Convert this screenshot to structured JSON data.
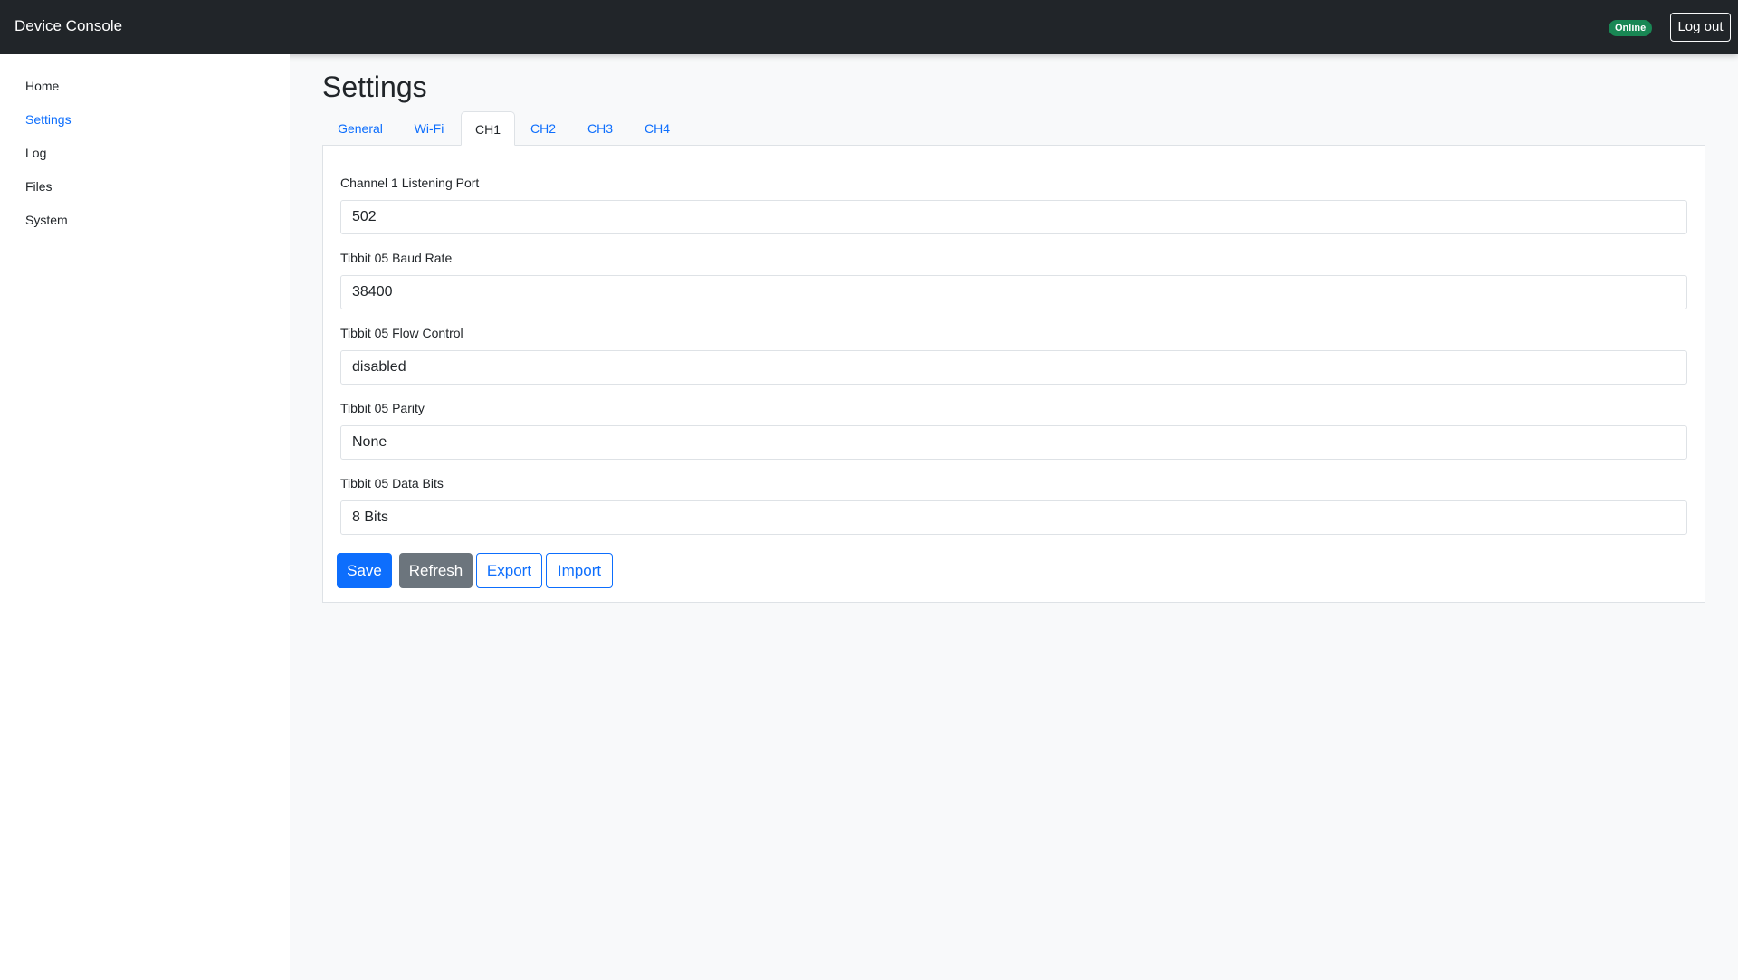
{
  "app": {
    "title": "Device Console"
  },
  "header": {
    "status": "Online",
    "logout_label": "Log out"
  },
  "sidebar": {
    "items": [
      {
        "label": "Home"
      },
      {
        "label": "Settings",
        "active": true
      },
      {
        "label": "Log"
      },
      {
        "label": "Files"
      },
      {
        "label": "System"
      }
    ]
  },
  "page": {
    "title": "Settings"
  },
  "tabs": [
    {
      "label": "General"
    },
    {
      "label": "Wi-Fi"
    },
    {
      "label": "CH1",
      "active": true
    },
    {
      "label": "CH2"
    },
    {
      "label": "CH3"
    },
    {
      "label": "CH4"
    }
  ],
  "form": {
    "fields": [
      {
        "label": "Channel 1 Listening Port",
        "value": "502"
      },
      {
        "label": "Tibbit 05 Baud Rate",
        "value": "38400"
      },
      {
        "label": "Tibbit 05 Flow Control",
        "value": "disabled"
      },
      {
        "label": "Tibbit 05 Parity",
        "value": "None"
      },
      {
        "label": "Tibbit 05 Data Bits",
        "value": "8 Bits"
      }
    ]
  },
  "actions": {
    "save_label": "Save",
    "refresh_label": "Refresh",
    "export_label": "Export",
    "import_label": "Import"
  },
  "colors": {
    "accent": "#0d6efd",
    "topbar": "#212529",
    "status": "#198754",
    "secondary": "#6c757d"
  }
}
